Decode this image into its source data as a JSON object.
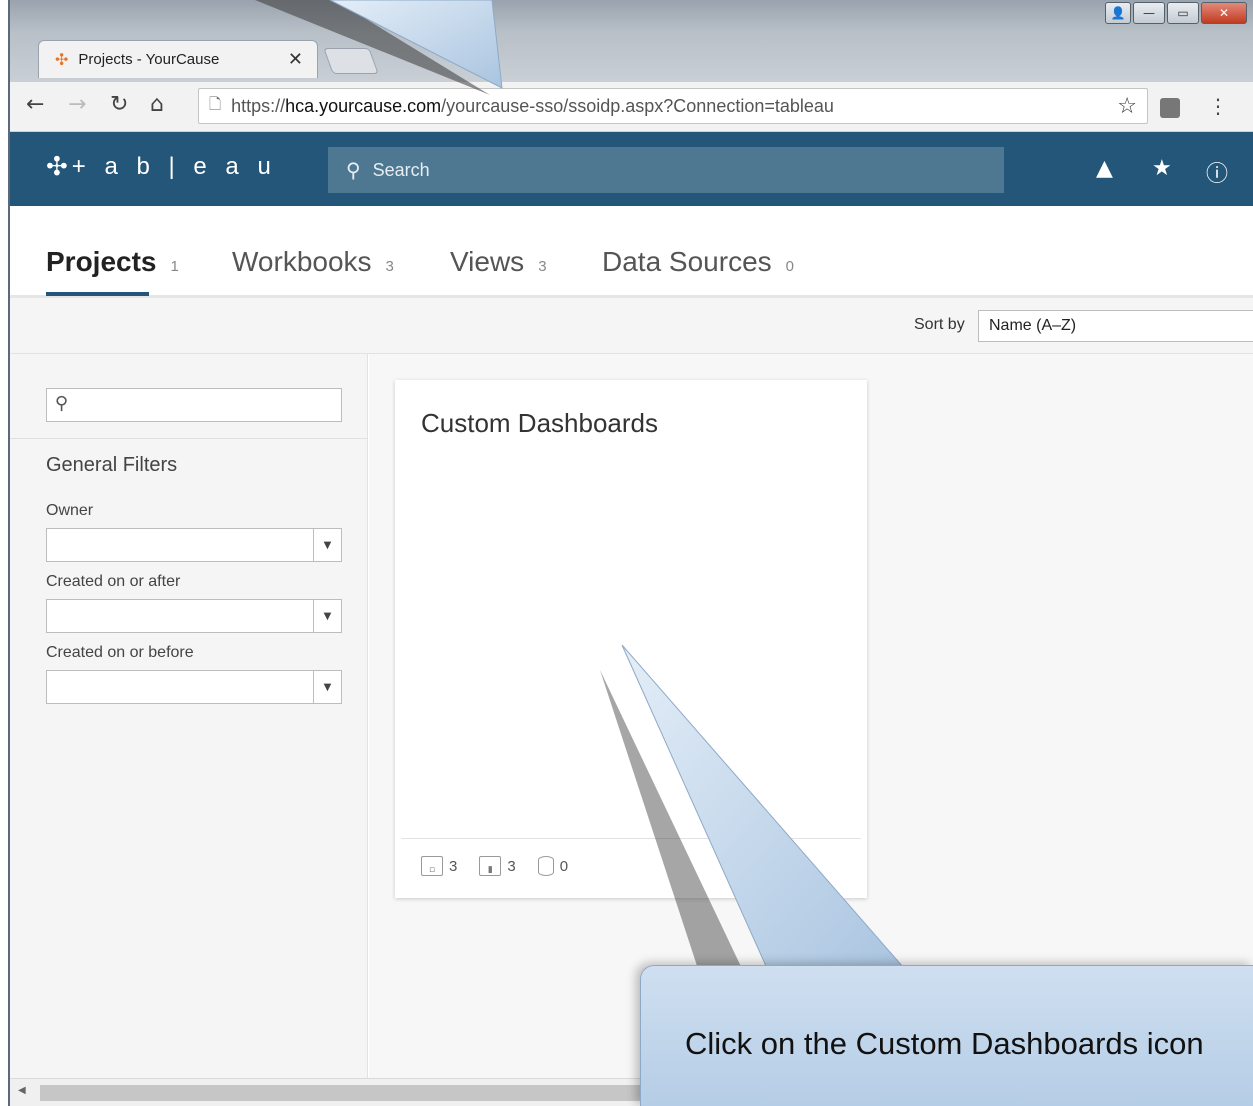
{
  "browser": {
    "tab_title": "Projects - YourCause",
    "tab_close": "✕",
    "url_prefix": "https://",
    "url_host": "hca.yourcause.com",
    "url_path": "/yourcause-sso/ssoidp.aspx?Connection=tableau",
    "icons": [
      "back-icon",
      "forward-icon",
      "reload-icon",
      "home-icon",
      "page-icon",
      "star-icon",
      "extension-icon",
      "menu-icon"
    ]
  },
  "window_controls": [
    "user-icon",
    "minimize-icon",
    "maximize-icon",
    "close-icon"
  ],
  "header": {
    "logo_text": "+ a b | e a u",
    "search_placeholder": "Search",
    "icons": [
      "alert-icon",
      "favorites-icon",
      "info-icon"
    ],
    "background": "#235678"
  },
  "content_tabs": [
    {
      "label": "Projects",
      "count": "1",
      "active": true
    },
    {
      "label": "Workbooks",
      "count": "3",
      "active": false
    },
    {
      "label": "Views",
      "count": "3",
      "active": false
    },
    {
      "label": "Data Sources",
      "count": "0",
      "active": false
    }
  ],
  "sort": {
    "label": "Sort by",
    "value": "Name (A–Z)"
  },
  "filters": {
    "title": "General Filters",
    "owner_label": "Owner",
    "after_label": "Created on or after",
    "before_label": "Created on or before"
  },
  "card": {
    "title": "Custom Dashboards",
    "workbooks_count": "3",
    "views_count": "3",
    "datasources_count": "0"
  },
  "callout": {
    "text": "Click on the Custom Dashboards icon"
  }
}
